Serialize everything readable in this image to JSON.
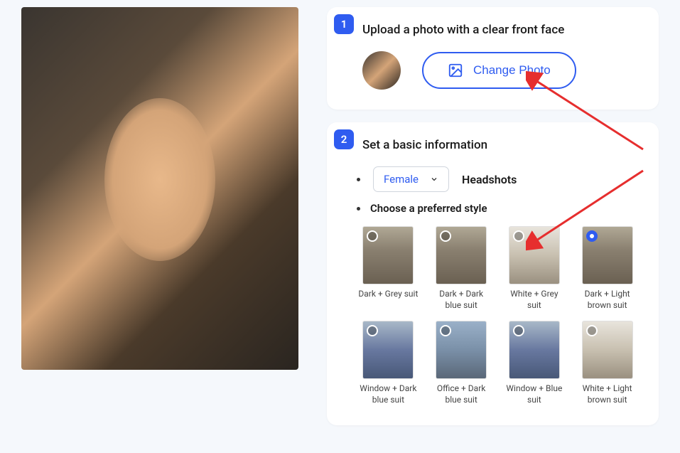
{
  "step1": {
    "number": "1",
    "title": "Upload a photo with a clear front face",
    "button_label": "Change Photo"
  },
  "step2": {
    "number": "2",
    "title": "Set a basic information",
    "gender_selected": "Female",
    "headshots_label": "Headshots",
    "style_prompt": "Choose a preferred style",
    "styles": [
      {
        "label": "Dark + Grey suit",
        "selected": false,
        "bg": ""
      },
      {
        "label": "Dark + Dark blue suit",
        "selected": false,
        "bg": ""
      },
      {
        "label": "White + Grey suit",
        "selected": false,
        "bg": "white-bg"
      },
      {
        "label": "Dark + Light brown suit",
        "selected": true,
        "bg": ""
      },
      {
        "label": "Window + Dark blue suit",
        "selected": false,
        "bg": "window-bg"
      },
      {
        "label": "Office + Dark blue suit",
        "selected": false,
        "bg": "office-bg"
      },
      {
        "label": "Window + Blue suit",
        "selected": false,
        "bg": "window-bg"
      },
      {
        "label": "White + Light brown suit",
        "selected": false,
        "bg": "white-bg"
      }
    ]
  }
}
